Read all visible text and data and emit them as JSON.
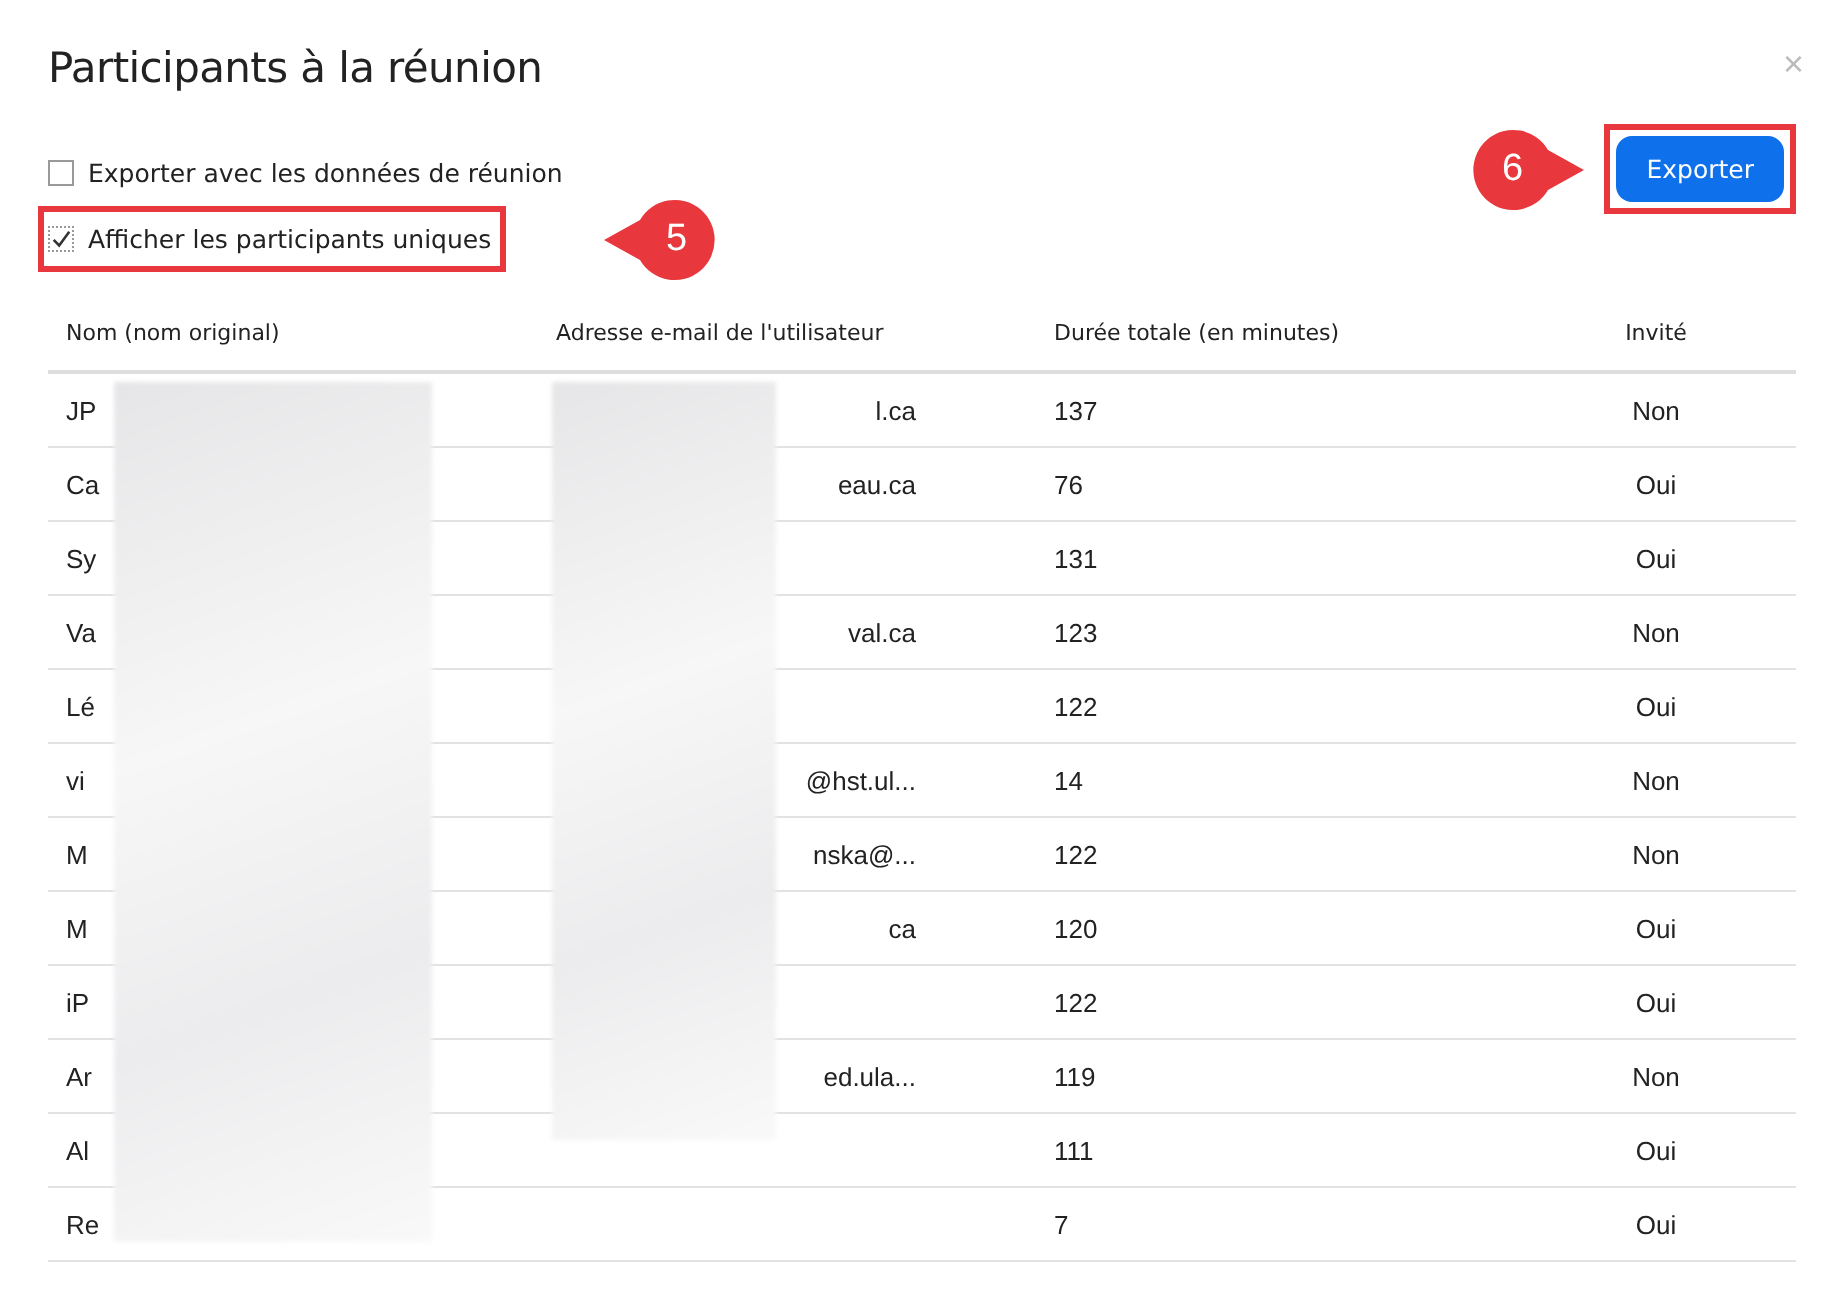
{
  "dialog": {
    "title": "Participants à la réunion",
    "close": "×"
  },
  "options": [
    {
      "label": "Exporter avec les données de réunion",
      "checked": false,
      "highlighted": false
    },
    {
      "label": "Afficher les participants uniques",
      "checked": true,
      "highlighted": true,
      "callout": "5"
    }
  ],
  "export_button": {
    "label": "Exporter",
    "highlighted": true,
    "callout": "6"
  },
  "table": {
    "columns": [
      "Nom (nom original)",
      "Adresse e-mail de l'utilisateur",
      "Durée totale (en minutes)",
      "Invité"
    ],
    "rows": [
      {
        "name": "JP",
        "email": "l.ca",
        "duration": "137",
        "guest": "Non"
      },
      {
        "name": "Ca",
        "email": "eau.ca",
        "duration": "76",
        "guest": "Oui"
      },
      {
        "name": "Sy",
        "duration": "131",
        "guest": "Oui"
      },
      {
        "name": "Va",
        "email": "val.ca",
        "duration": "123",
        "guest": "Non"
      },
      {
        "name": "Lé",
        "duration": "122",
        "guest": "Oui"
      },
      {
        "name": "vi",
        "email": "@hst.ul...",
        "duration": "14",
        "guest": "Non"
      },
      {
        "name": "M",
        "email": "nska@...",
        "duration": "122",
        "guest": "Non"
      },
      {
        "name": "M",
        "email": "ca",
        "duration": "120",
        "guest": "Oui"
      },
      {
        "name": "iP",
        "duration": "122",
        "guest": "Oui"
      },
      {
        "name": "Ar",
        "email": "ed.ula...",
        "duration": "119",
        "guest": "Non"
      },
      {
        "name": "Al",
        "duration": "111",
        "guest": "Oui"
      },
      {
        "name": "Re",
        "duration": "7",
        "guest": "Oui"
      }
    ]
  }
}
